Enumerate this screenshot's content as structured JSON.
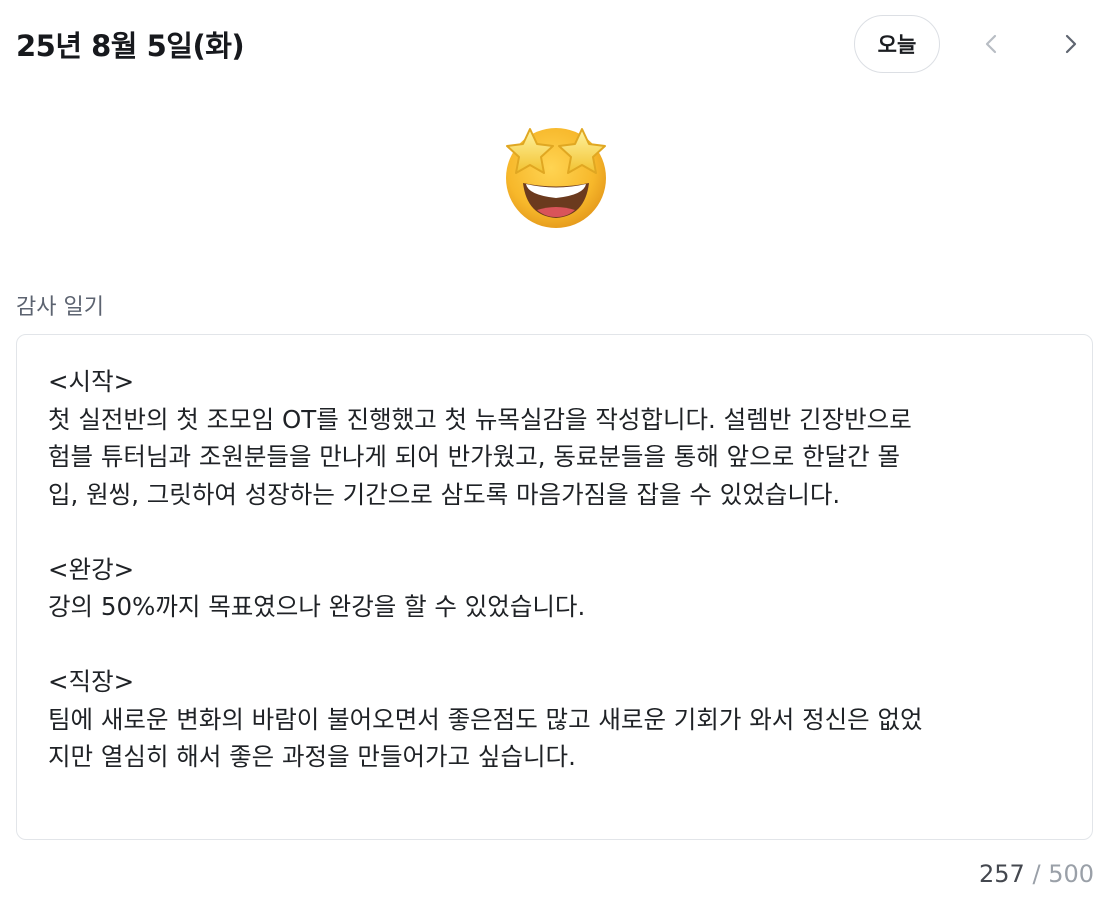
{
  "header": {
    "date": "25년 8월 5일(화)",
    "today_label": "오늘",
    "prev_icon": "chevron-left-icon",
    "next_icon": "chevron-right-icon"
  },
  "mood": {
    "emoji": "star-struck",
    "icon": "star-struck-emoji-icon"
  },
  "journal": {
    "label": "감사 일기",
    "content": "<시작>\n첫 실전반의 첫 조모임 OT를 진행했고 첫 뉴목실감을 작성합니다. 설렘반 긴장반으로\n험블 튜터님과 조원분들을 만나게 되어 반가웠고, 동료분들을 통해 앞으로 한달간 몰\n입, 원씽, 그릿하여 성장하는 기간으로 삼도록 마음가짐을 잡을 수 있었습니다.\n\n<완강>\n강의 50%까지 목표였으나 완강을 할 수 있었습니다.\n\n<직장>\n팀에 새로운 변화의 바람이 불어오면서 좋은점도 많고 새로운 기회가 와서 정신은 없었\n지만 열심히 해서 좋은 과정을 만들어가고 싶습니다."
  },
  "counter": {
    "current": "257",
    "separator": "/",
    "max": "500"
  }
}
